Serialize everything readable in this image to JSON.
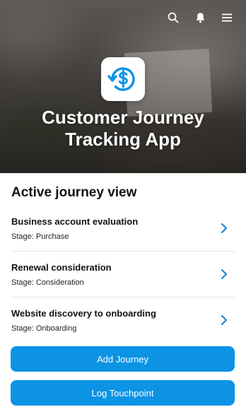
{
  "header": {
    "title": "Customer Journey Tracking App",
    "icons": [
      "search-icon",
      "bell-icon",
      "menu-icon"
    ]
  },
  "logo": {
    "icon": "dollar-refresh-icon",
    "color": "#0c93e4"
  },
  "section": {
    "title": "Active journey view"
  },
  "journeys": [
    {
      "title": "Business account evaluation",
      "stage": "Stage: Purchase"
    },
    {
      "title": "Renewal consideration",
      "stage": "Stage: Consideration"
    },
    {
      "title": "Website discovery to onboarding",
      "stage": "Stage: Onboarding"
    }
  ],
  "actions": {
    "add_label": "Add Journey",
    "log_label": "Log Touchpoint"
  },
  "colors": {
    "accent": "#0c93e4",
    "chevron": "#0c7fd0"
  }
}
